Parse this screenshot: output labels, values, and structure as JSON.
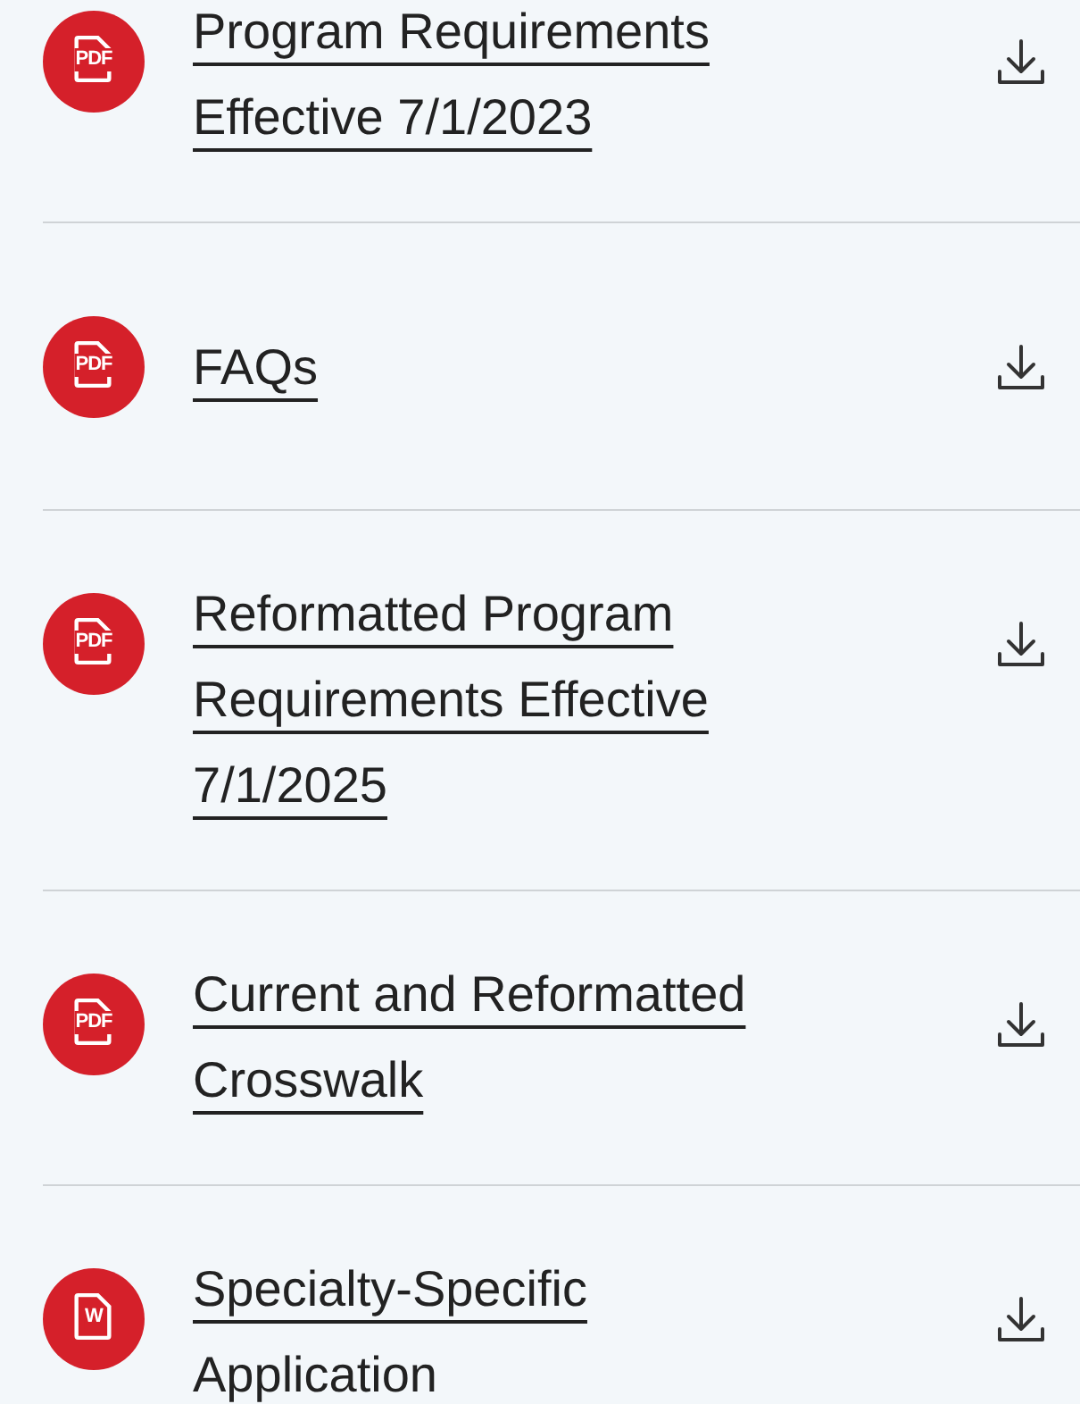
{
  "documents": [
    {
      "file_label": "PDF",
      "title": "Program Requirements Effective 7/1/2023"
    },
    {
      "file_label": "PDF",
      "title": "FAQs"
    },
    {
      "file_label": "PDF",
      "title": "Reformatted Program Requirements Effective 7/1/2025"
    },
    {
      "file_label": "PDF",
      "title": "Current and Reformatted Crosswalk"
    },
    {
      "file_label": "W",
      "title": "Specialty-Specific Application"
    }
  ]
}
